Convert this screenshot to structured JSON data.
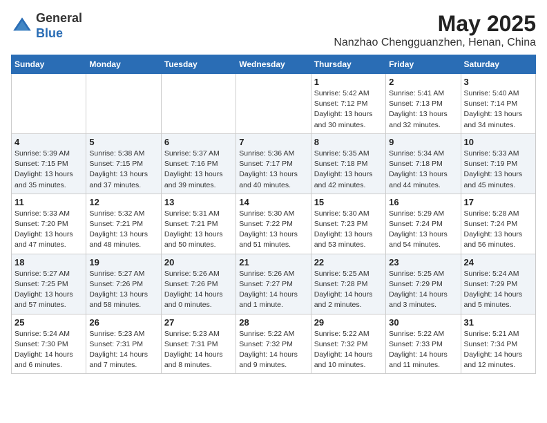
{
  "header": {
    "logo_line1": "General",
    "logo_line2": "Blue",
    "month": "May 2025",
    "location": "Nanzhao Chengguanzhen, Henan, China"
  },
  "columns": [
    "Sunday",
    "Monday",
    "Tuesday",
    "Wednesday",
    "Thursday",
    "Friday",
    "Saturday"
  ],
  "weeks": [
    [
      {
        "day": "",
        "info": ""
      },
      {
        "day": "",
        "info": ""
      },
      {
        "day": "",
        "info": ""
      },
      {
        "day": "",
        "info": ""
      },
      {
        "day": "1",
        "info": "Sunrise: 5:42 AM\nSunset: 7:12 PM\nDaylight: 13 hours\nand 30 minutes."
      },
      {
        "day": "2",
        "info": "Sunrise: 5:41 AM\nSunset: 7:13 PM\nDaylight: 13 hours\nand 32 minutes."
      },
      {
        "day": "3",
        "info": "Sunrise: 5:40 AM\nSunset: 7:14 PM\nDaylight: 13 hours\nand 34 minutes."
      }
    ],
    [
      {
        "day": "4",
        "info": "Sunrise: 5:39 AM\nSunset: 7:15 PM\nDaylight: 13 hours\nand 35 minutes."
      },
      {
        "day": "5",
        "info": "Sunrise: 5:38 AM\nSunset: 7:15 PM\nDaylight: 13 hours\nand 37 minutes."
      },
      {
        "day": "6",
        "info": "Sunrise: 5:37 AM\nSunset: 7:16 PM\nDaylight: 13 hours\nand 39 minutes."
      },
      {
        "day": "7",
        "info": "Sunrise: 5:36 AM\nSunset: 7:17 PM\nDaylight: 13 hours\nand 40 minutes."
      },
      {
        "day": "8",
        "info": "Sunrise: 5:35 AM\nSunset: 7:18 PM\nDaylight: 13 hours\nand 42 minutes."
      },
      {
        "day": "9",
        "info": "Sunrise: 5:34 AM\nSunset: 7:18 PM\nDaylight: 13 hours\nand 44 minutes."
      },
      {
        "day": "10",
        "info": "Sunrise: 5:33 AM\nSunset: 7:19 PM\nDaylight: 13 hours\nand 45 minutes."
      }
    ],
    [
      {
        "day": "11",
        "info": "Sunrise: 5:33 AM\nSunset: 7:20 PM\nDaylight: 13 hours\nand 47 minutes."
      },
      {
        "day": "12",
        "info": "Sunrise: 5:32 AM\nSunset: 7:21 PM\nDaylight: 13 hours\nand 48 minutes."
      },
      {
        "day": "13",
        "info": "Sunrise: 5:31 AM\nSunset: 7:21 PM\nDaylight: 13 hours\nand 50 minutes."
      },
      {
        "day": "14",
        "info": "Sunrise: 5:30 AM\nSunset: 7:22 PM\nDaylight: 13 hours\nand 51 minutes."
      },
      {
        "day": "15",
        "info": "Sunrise: 5:30 AM\nSunset: 7:23 PM\nDaylight: 13 hours\nand 53 minutes."
      },
      {
        "day": "16",
        "info": "Sunrise: 5:29 AM\nSunset: 7:24 PM\nDaylight: 13 hours\nand 54 minutes."
      },
      {
        "day": "17",
        "info": "Sunrise: 5:28 AM\nSunset: 7:24 PM\nDaylight: 13 hours\nand 56 minutes."
      }
    ],
    [
      {
        "day": "18",
        "info": "Sunrise: 5:27 AM\nSunset: 7:25 PM\nDaylight: 13 hours\nand 57 minutes."
      },
      {
        "day": "19",
        "info": "Sunrise: 5:27 AM\nSunset: 7:26 PM\nDaylight: 13 hours\nand 58 minutes."
      },
      {
        "day": "20",
        "info": "Sunrise: 5:26 AM\nSunset: 7:26 PM\nDaylight: 14 hours\nand 0 minutes."
      },
      {
        "day": "21",
        "info": "Sunrise: 5:26 AM\nSunset: 7:27 PM\nDaylight: 14 hours\nand 1 minute."
      },
      {
        "day": "22",
        "info": "Sunrise: 5:25 AM\nSunset: 7:28 PM\nDaylight: 14 hours\nand 2 minutes."
      },
      {
        "day": "23",
        "info": "Sunrise: 5:25 AM\nSunset: 7:29 PM\nDaylight: 14 hours\nand 3 minutes."
      },
      {
        "day": "24",
        "info": "Sunrise: 5:24 AM\nSunset: 7:29 PM\nDaylight: 14 hours\nand 5 minutes."
      }
    ],
    [
      {
        "day": "25",
        "info": "Sunrise: 5:24 AM\nSunset: 7:30 PM\nDaylight: 14 hours\nand 6 minutes."
      },
      {
        "day": "26",
        "info": "Sunrise: 5:23 AM\nSunset: 7:31 PM\nDaylight: 14 hours\nand 7 minutes."
      },
      {
        "day": "27",
        "info": "Sunrise: 5:23 AM\nSunset: 7:31 PM\nDaylight: 14 hours\nand 8 minutes."
      },
      {
        "day": "28",
        "info": "Sunrise: 5:22 AM\nSunset: 7:32 PM\nDaylight: 14 hours\nand 9 minutes."
      },
      {
        "day": "29",
        "info": "Sunrise: 5:22 AM\nSunset: 7:32 PM\nDaylight: 14 hours\nand 10 minutes."
      },
      {
        "day": "30",
        "info": "Sunrise: 5:22 AM\nSunset: 7:33 PM\nDaylight: 14 hours\nand 11 minutes."
      },
      {
        "day": "31",
        "info": "Sunrise: 5:21 AM\nSunset: 7:34 PM\nDaylight: 14 hours\nand 12 minutes."
      }
    ]
  ]
}
